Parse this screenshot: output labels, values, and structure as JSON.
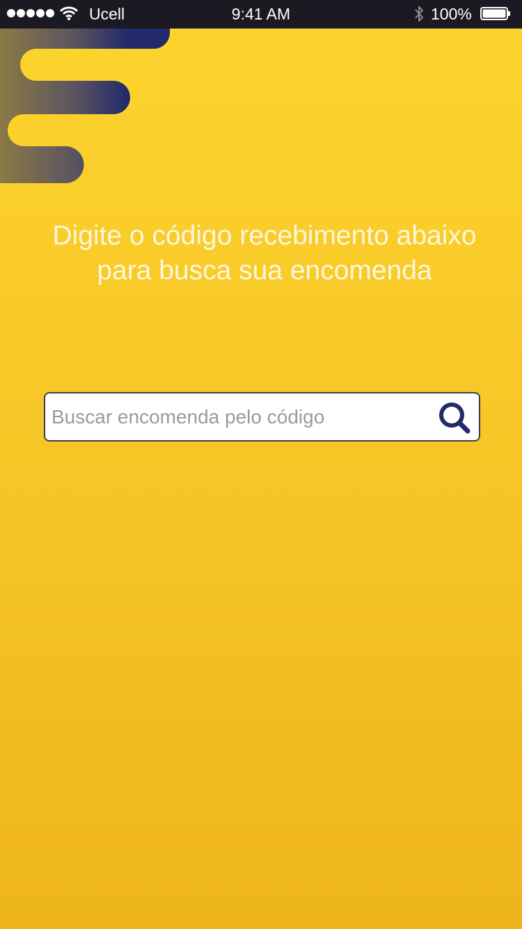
{
  "status_bar": {
    "carrier": "Ucell",
    "time": "9:41 AM",
    "battery": "100%",
    "signal_icon": "signal-dots-icon",
    "wifi_icon": "wifi-icon",
    "bluetooth_icon": "bluetooth-icon",
    "battery_icon": "battery-icon"
  },
  "logo": {
    "icon": "brand-logo-icon",
    "colors": [
      "#232a6b",
      "#8a7a45"
    ]
  },
  "heading": {
    "text": "Digite o código recebimento abaixo para busca sua encomenda"
  },
  "search": {
    "value": "",
    "placeholder": "Buscar encomenda pelo código",
    "icon": "search-icon",
    "icon_color": "#232a6b"
  },
  "colors": {
    "background_top": "#fdd42e",
    "background_bottom": "#eeb51c",
    "status_bar": "#1b1a22",
    "heading_text": "#fdf6de",
    "accent": "#232a6b"
  }
}
